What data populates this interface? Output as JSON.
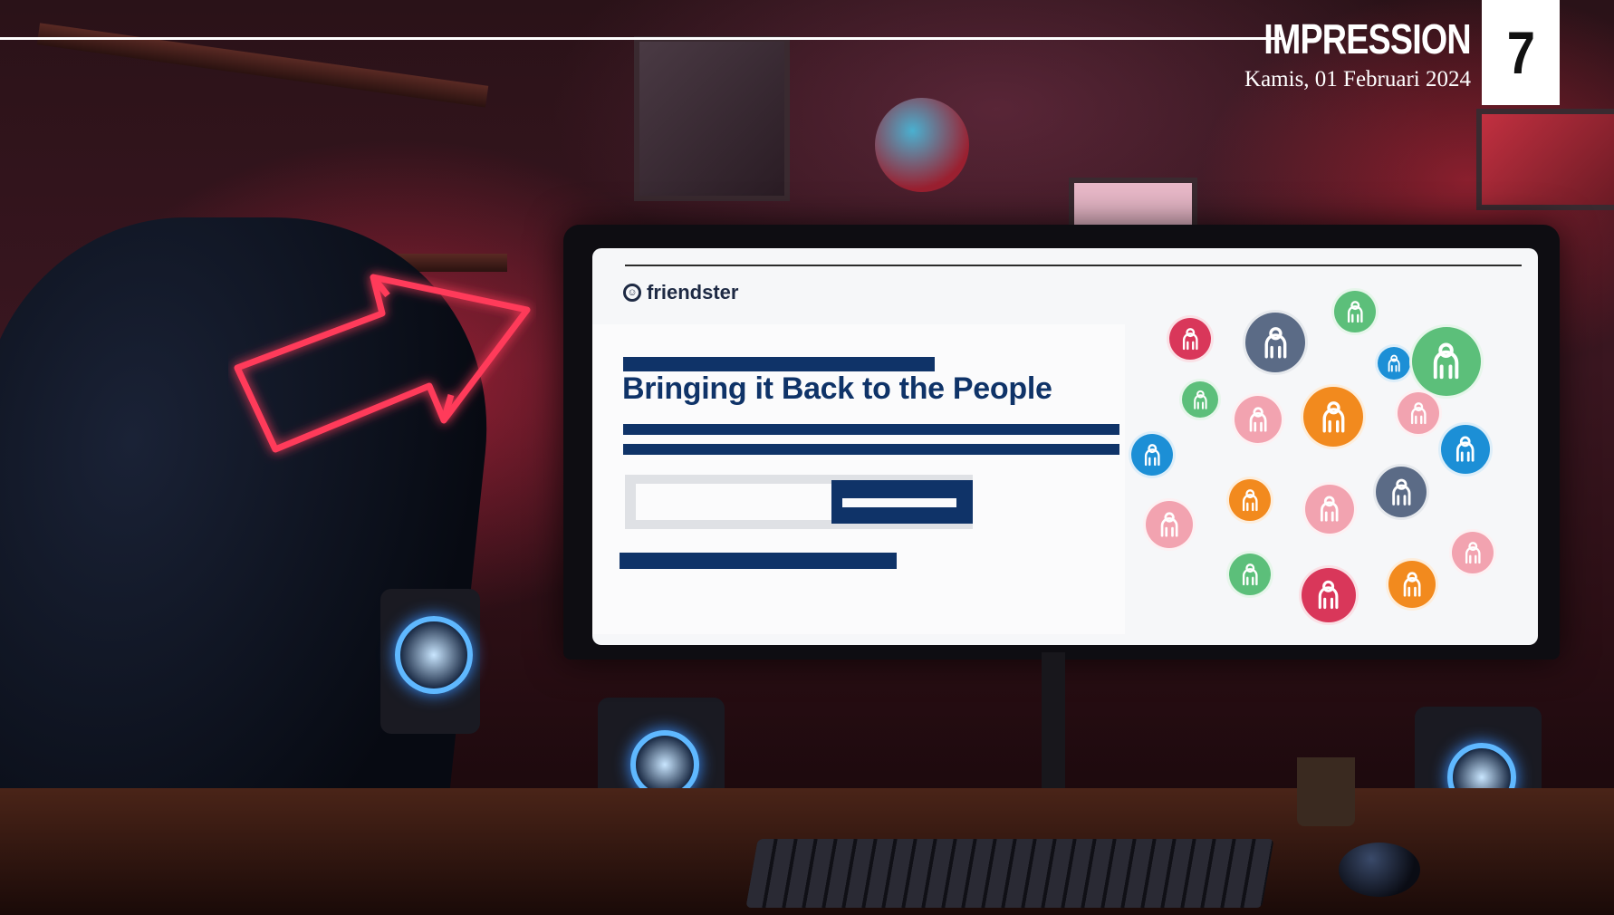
{
  "masthead": {
    "section_title": "IMPRESSION",
    "date": "Kamis, 01 Februari 2024",
    "page_number": "7"
  },
  "screen": {
    "logo_text": "friendster",
    "headline": "Bringing it Back to the People"
  },
  "colors": {
    "accent_navy": "#0f3368",
    "neon_red": "#ff2b4a",
    "avatar_red": "#d9375a",
    "avatar_slate": "#5b6b86",
    "avatar_green": "#5cbf7a",
    "avatar_blue": "#1c8fd6",
    "avatar_orange": "#f28a1e",
    "avatar_pink": "#f2a3b0"
  },
  "illustration": {
    "avatars": [
      "user-icon"
    ],
    "neon_sign": "arrow-icon"
  }
}
